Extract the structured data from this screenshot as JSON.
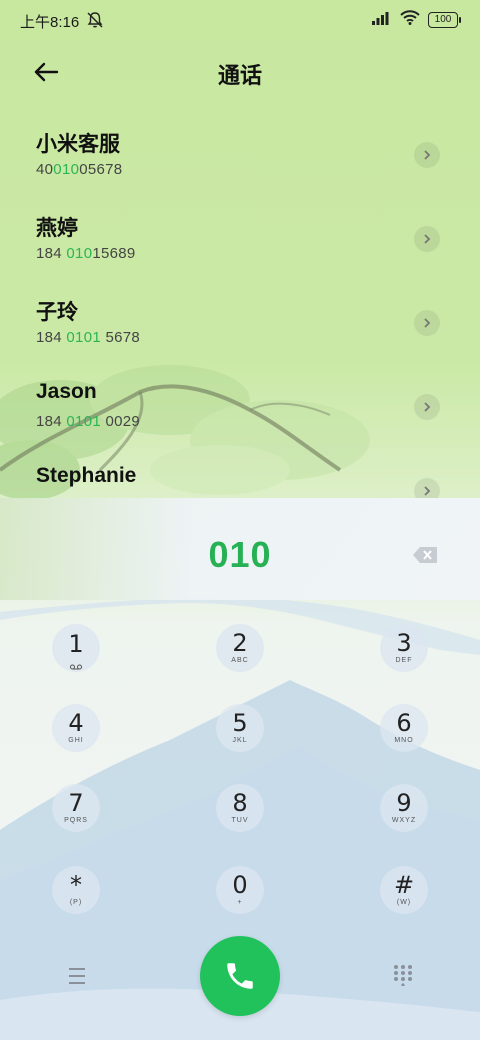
{
  "status_bar": {
    "time": "上午8:16",
    "battery": "100",
    "mute_icon": "bell-off-icon",
    "signal_icon": "signal-icon",
    "wifi_icon": "wifi-icon"
  },
  "header": {
    "title": "通话",
    "back_icon": "arrow-left-icon"
  },
  "contacts": [
    {
      "name": "小米客服",
      "number_pre": "40",
      "number_match": "010",
      "number_post": "05678"
    },
    {
      "name": "燕婷",
      "number_pre": "184 ",
      "number_match": "010",
      "number_post": "15689"
    },
    {
      "name": "子玲",
      "number_pre": "184 ",
      "number_match": "0101",
      "number_post": " 5678"
    },
    {
      "name": "Jason",
      "number_pre": "184 ",
      "number_match": "0101",
      "number_post": " 0029"
    },
    {
      "name": "Stephanie",
      "number_pre": "",
      "number_match": "",
      "number_post": ""
    }
  ],
  "dialer": {
    "input_value": "010",
    "backspace_icon": "backspace-icon"
  },
  "keypad": [
    {
      "digit": "1",
      "letters": ""
    },
    {
      "digit": "2",
      "letters": "ABC"
    },
    {
      "digit": "3",
      "letters": "DEF"
    },
    {
      "digit": "4",
      "letters": "GHI"
    },
    {
      "digit": "5",
      "letters": "JKL"
    },
    {
      "digit": "6",
      "letters": "MNO"
    },
    {
      "digit": "7",
      "letters": "PQRS"
    },
    {
      "digit": "8",
      "letters": "TUV"
    },
    {
      "digit": "9",
      "letters": "WXYZ"
    },
    {
      "digit": "*",
      "letters": "(P)"
    },
    {
      "digit": "0",
      "letters": "+"
    },
    {
      "digit": "#",
      "letters": "(W)"
    }
  ],
  "bottom": {
    "menu_icon": "menu-icon",
    "call_icon": "phone-icon",
    "keypad_icon": "dialpad-icon"
  },
  "colors": {
    "accent": "#27b155",
    "call_button": "#21c25c"
  }
}
